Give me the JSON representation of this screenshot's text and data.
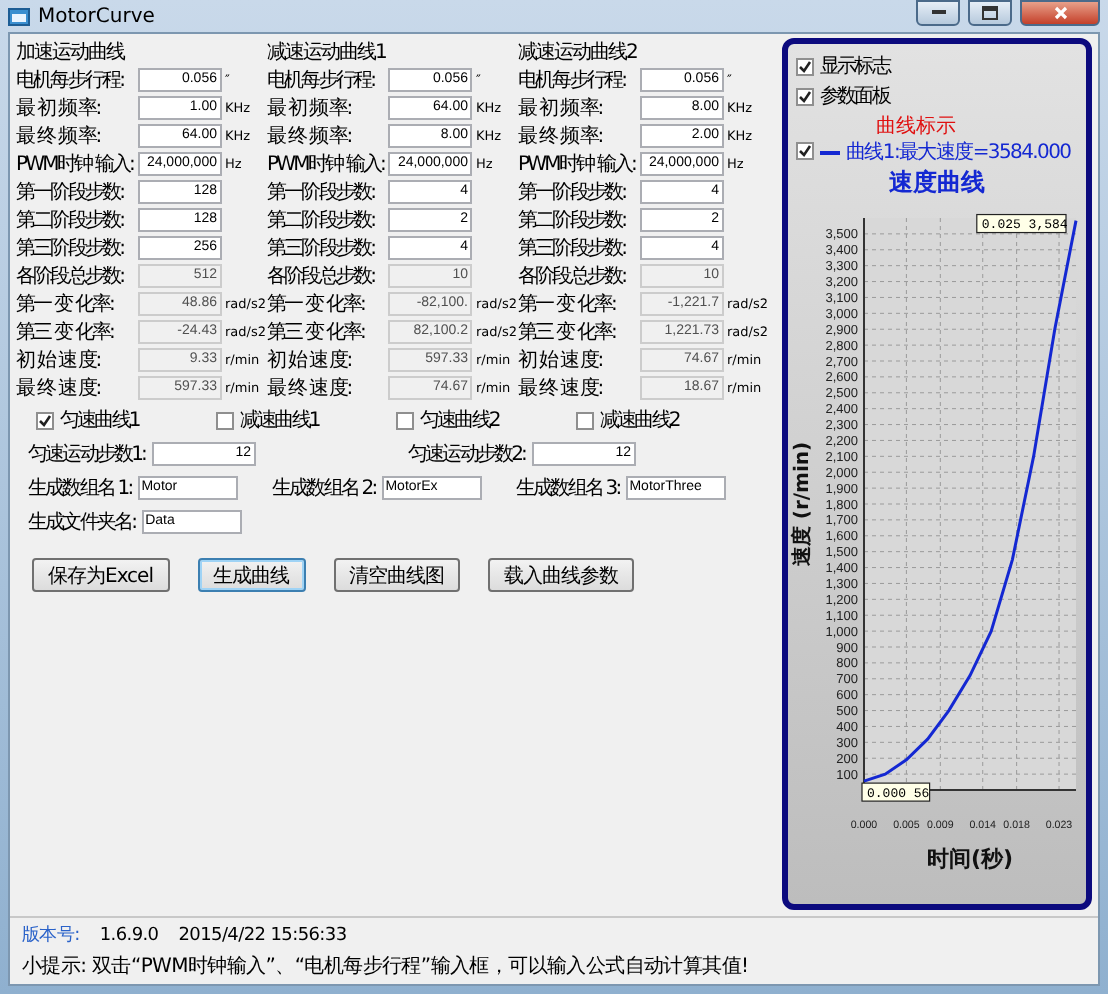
{
  "window": {
    "title": "MotorCurve"
  },
  "groups": [
    {
      "title": "加速运动曲线",
      "fields": [
        {
          "label": "电机每步行程:",
          "value": "0.056",
          "unit": "″",
          "readonly": false
        },
        {
          "label": "最 初 频 率:",
          "value": "1.00",
          "unit": "KHz",
          "readonly": false
        },
        {
          "label": "最 终 频 率:",
          "value": "64.00",
          "unit": "KHz",
          "readonly": false
        },
        {
          "label": "PWM时钟 输入:",
          "value": "24,000,000",
          "unit": "Hz",
          "readonly": false
        },
        {
          "label": "第一阶段步数:",
          "value": "128",
          "readonly": false
        },
        {
          "label": "第二阶段步数:",
          "value": "128",
          "readonly": false
        },
        {
          "label": "第三阶段步数:",
          "value": "256",
          "readonly": false
        },
        {
          "label": "各阶段总步数:",
          "value": "512",
          "readonly": true
        },
        {
          "label": "第一 变 化率:",
          "value": "48.86",
          "unit": "rad/s2",
          "readonly": true
        },
        {
          "label": "第三 变 化率:",
          "value": "-24.43",
          "unit": "rad/s2",
          "readonly": true
        },
        {
          "label": "初 始 速 度:",
          "value": "9.33",
          "unit": "r/min",
          "readonly": true
        },
        {
          "label": "最 终 速 度:",
          "value": "597.33",
          "unit": "r/min",
          "readonly": true
        }
      ]
    },
    {
      "title": "减速运动曲线1",
      "fields": [
        {
          "label": "电机每步行程:",
          "value": "0.056",
          "unit": "″",
          "readonly": false
        },
        {
          "label": "最 初 频 率:",
          "value": "64.00",
          "unit": "KHz",
          "readonly": false
        },
        {
          "label": "最 终 频 率:",
          "value": "8.00",
          "unit": "KHz",
          "readonly": false
        },
        {
          "label": "PWM时钟 输入:",
          "value": "24,000,000",
          "unit": "Hz",
          "readonly": false
        },
        {
          "label": "第一阶段步数:",
          "value": "4",
          "readonly": false
        },
        {
          "label": "第二阶段步数:",
          "value": "2",
          "readonly": false
        },
        {
          "label": "第三阶段步数:",
          "value": "4",
          "readonly": false
        },
        {
          "label": "各阶段总步数:",
          "value": "10",
          "readonly": true
        },
        {
          "label": "第一 变 化率:",
          "value": "-82,100.",
          "unit": "rad/s2",
          "readonly": true
        },
        {
          "label": "第三 变 化率:",
          "value": "82,100.2",
          "unit": "rad/s2",
          "readonly": true
        },
        {
          "label": "初 始 速 度:",
          "value": "597.33",
          "unit": "r/min",
          "readonly": true
        },
        {
          "label": "最 终 速 度:",
          "value": "74.67",
          "unit": "r/min",
          "readonly": true
        }
      ]
    },
    {
      "title": "减速运动曲线2",
      "fields": [
        {
          "label": "电机每步行程:",
          "value": "0.056",
          "unit": "″",
          "readonly": false
        },
        {
          "label": "最 初 频 率:",
          "value": "8.00",
          "unit": "KHz",
          "readonly": false
        },
        {
          "label": "最 终 频 率:",
          "value": "2.00",
          "unit": "KHz",
          "readonly": false
        },
        {
          "label": "PWM时钟 输入:",
          "value": "24,000,000",
          "unit": "Hz",
          "readonly": false
        },
        {
          "label": "第一阶段步数:",
          "value": "4",
          "readonly": false
        },
        {
          "label": "第二阶段步数:",
          "value": "2",
          "readonly": false
        },
        {
          "label": "第三阶段步数:",
          "value": "4",
          "readonly": false
        },
        {
          "label": "各阶段总步数:",
          "value": "10",
          "readonly": true
        },
        {
          "label": "第一 变 化率:",
          "value": "-1,221.7",
          "unit": "rad/s2",
          "readonly": true
        },
        {
          "label": "第三 变 化率:",
          "value": "1,221.73",
          "unit": "rad/s2",
          "readonly": true
        },
        {
          "label": "初 始 速 度:",
          "value": "74.67",
          "unit": "r/min",
          "readonly": true
        },
        {
          "label": "最 终 速 度:",
          "value": "18.67",
          "unit": "r/min",
          "readonly": true
        }
      ]
    }
  ],
  "options": [
    {
      "label": "匀速曲线1",
      "checked": true
    },
    {
      "label": "减速曲线1",
      "checked": false
    },
    {
      "label": "匀速曲线2",
      "checked": false
    },
    {
      "label": "减速曲线2",
      "checked": false
    }
  ],
  "steps": [
    {
      "label": "匀速运动步数1:",
      "value": "12"
    },
    {
      "label": "匀速运动步数2:",
      "value": "12"
    }
  ],
  "names": [
    {
      "label": "生成数组名 1:",
      "value": "Motor"
    },
    {
      "label": "生成数组名 2:",
      "value": "MotorEx"
    },
    {
      "label": "生成数组名 3:",
      "value": "MotorThree"
    },
    {
      "label": "生成文件夹名:",
      "value": "Data"
    }
  ],
  "buttons": [
    {
      "label": "保存为Excel",
      "focused": false
    },
    {
      "label": "生成曲线",
      "focused": true
    },
    {
      "label": "清空曲线图",
      "focused": false
    },
    {
      "label": "载入曲线参数",
      "focused": false
    }
  ],
  "chart": {
    "checkboxes": [
      {
        "label": "显示标志",
        "checked": true
      },
      {
        "label": "参数面板",
        "checked": true
      }
    ],
    "legend": {
      "title": "曲线标示",
      "entries": [
        {
          "checked": true
        }
      ]
    },
    "chart_data": {
      "type": "line",
      "title": "速度曲线",
      "xlabel": "时间(秒)",
      "ylabel": "速度 (r/min)",
      "x": [
        0,
        0.0025,
        0.005,
        0.0075,
        0.01,
        0.0125,
        0.015,
        0.0175,
        0.02,
        0.0225,
        0.025
      ],
      "series": [
        {
          "name": "曲线1:最大速度=3584.000",
          "color": "#1428d2",
          "values": [
            56,
            100,
            190,
            320,
            500,
            720,
            1000,
            1450,
            2100,
            2900,
            3584
          ]
        }
      ],
      "xlim": [
        0,
        0.025
      ],
      "ylim": [
        0,
        3600
      ],
      "grid": true,
      "xticks": [
        {
          "value": 0,
          "label": "0.000"
        },
        {
          "value": 0.005,
          "label": "0.005"
        },
        {
          "value": 0.009,
          "label": "0.009"
        },
        {
          "value": 0.014,
          "label": "0.014"
        },
        {
          "value": 0.018,
          "label": "0.018"
        },
        {
          "value": 0.023,
          "label": "0.023"
        }
      ],
      "yticks": [
        100,
        200,
        300,
        400,
        500,
        600,
        700,
        800,
        900,
        {
          "value": 1000,
          "label": "1,000"
        },
        {
          "value": 1100,
          "label": "1,100"
        },
        {
          "value": 1200,
          "label": "1,200"
        },
        {
          "value": 1300,
          "label": "1,300"
        },
        {
          "value": 1400,
          "label": "1,400"
        },
        {
          "value": 1500,
          "label": "1,500"
        },
        {
          "value": 1600,
          "label": "1,600"
        },
        {
          "value": 1700,
          "label": "1,700"
        },
        {
          "value": 1800,
          "label": "1,800"
        },
        {
          "value": 1900,
          "label": "1,900"
        },
        {
          "value": 2000,
          "label": "2,000"
        },
        {
          "value": 2100,
          "label": "2,100"
        },
        {
          "value": 2200,
          "label": "2,200"
        },
        {
          "value": 2300,
          "label": "2,300"
        },
        {
          "value": 2400,
          "label": "2,400"
        },
        {
          "value": 2500,
          "label": "2,500"
        },
        {
          "value": 2600,
          "label": "2,600"
        },
        {
          "value": 2700,
          "label": "2,700"
        },
        {
          "value": 2800,
          "label": "2,800"
        },
        {
          "value": 2900,
          "label": "2,900"
        },
        {
          "value": 3000,
          "label": "3,000"
        },
        {
          "value": 3100,
          "label": "3,100"
        },
        {
          "value": 3200,
          "label": "3,200"
        },
        {
          "value": 3300,
          "label": "3,300"
        },
        {
          "value": 3400,
          "label": "3,400"
        },
        {
          "value": 3500,
          "label": "3,500"
        }
      ],
      "annotations": [
        {
          "x": 0.025,
          "y": 3584,
          "text": "0.025 3,584"
        },
        {
          "x": 0,
          "y": 56,
          "text": "0.000 56"
        }
      ]
    }
  },
  "status_bar": {
    "version_label": "版本号:",
    "version": "1.6.9.0",
    "datetime": "2015/4/22 15:56:33",
    "hint": "小提示: 双击“PWM时钟输入”、“电机每步行程”输入框，可以输入公式自动计算其值!"
  }
}
